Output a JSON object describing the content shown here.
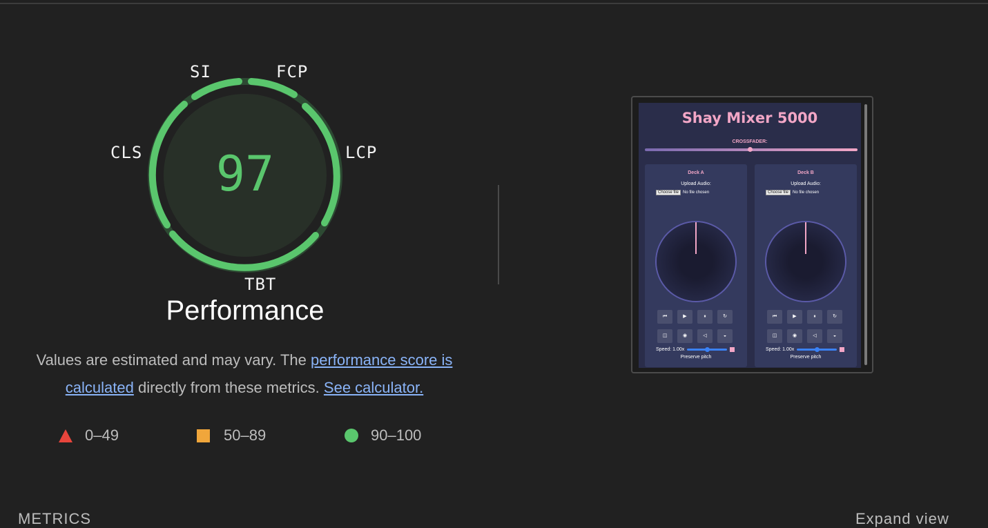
{
  "gauge": {
    "score": "97",
    "title": "Performance",
    "score_color": "#5ac66d",
    "metric_labels": {
      "si": "SI",
      "fcp": "FCP",
      "lcp": "LCP",
      "tbt": "TBT",
      "cls": "CLS"
    }
  },
  "description": {
    "text_before": "Values are estimated and may vary. The ",
    "link1": "performance score is calculated",
    "text_middle": " directly from these metrics. ",
    "link2": "See calculator."
  },
  "legend": {
    "items": [
      {
        "range": "0–49",
        "color": "#e8453c",
        "shape": "triangle"
      },
      {
        "range": "50–89",
        "color": "#f0a63b",
        "shape": "square"
      },
      {
        "range": "90–100",
        "color": "#5ac66d",
        "shape": "circle"
      }
    ]
  },
  "screenshot": {
    "app_title": "Shay Mixer 5000",
    "crossfader_label": "CROSSFADER:",
    "decks": [
      {
        "title": "Deck A",
        "upload_label": "Upload Audio:",
        "file_button": "Choose file",
        "file_status": "No file chosen",
        "speed_label": "Speed: 1.00x",
        "preserve_label": "Preserve pitch"
      },
      {
        "title": "Deck B",
        "upload_label": "Upload Audio:",
        "file_button": "Choose file",
        "file_status": "No file chosen",
        "speed_label": "Speed: 1.00x",
        "preserve_label": "Preserve pitch"
      }
    ],
    "control_icons_row1": [
      "⏮",
      "▶",
      "⏸",
      "↻"
    ],
    "control_icons_row2": [
      "◫",
      "◉",
      "◁",
      "◒"
    ]
  },
  "section": {
    "metrics_heading": "METRICS",
    "expand_view": "Expand view"
  }
}
